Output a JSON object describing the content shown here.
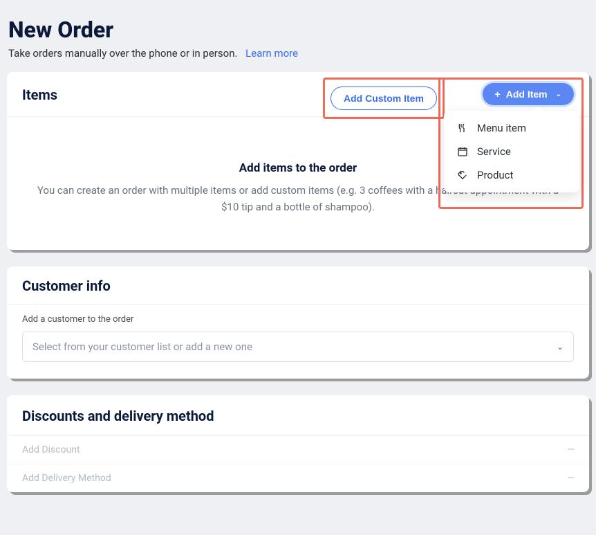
{
  "page": {
    "title": "New Order",
    "subtitle": "Take orders manually over the phone or in person.",
    "learn_more": "Learn more"
  },
  "items_card": {
    "title": "Items",
    "buttons": {
      "custom": "Add Custom Item",
      "add": "Add Item"
    },
    "dropdown": [
      {
        "label": "Menu item",
        "icon": "menu-item-icon"
      },
      {
        "label": "Service",
        "icon": "service-icon"
      },
      {
        "label": "Product",
        "icon": "product-icon"
      }
    ],
    "empty": {
      "heading": "Add items to the order",
      "text": "You can create an order with multiple items or add custom items (e.g. 3 coffees with a haircut appointment with a $10 tip and a bottle of shampoo)."
    }
  },
  "customer_card": {
    "title": "Customer info",
    "label": "Add a customer to the order",
    "placeholder": "Select from your customer list or add a new one"
  },
  "discount_card": {
    "title": "Discounts and delivery method",
    "rows": {
      "discount": "Add Discount",
      "delivery": "Add Delivery Method"
    },
    "dash": "—"
  }
}
